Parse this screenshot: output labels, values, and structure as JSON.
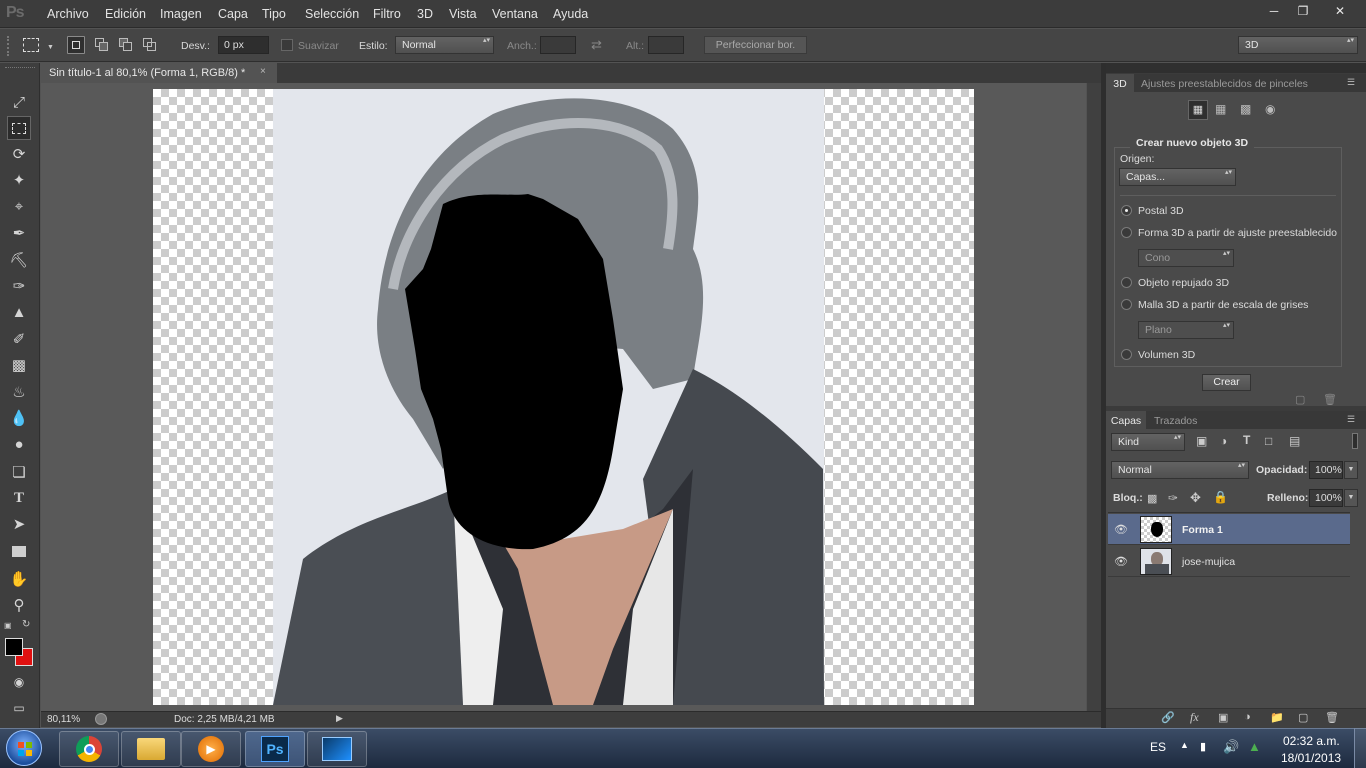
{
  "app": {
    "logo": "Ps"
  },
  "menu": [
    "Archivo",
    "Edición",
    "Imagen",
    "Capa",
    "Tipo",
    "Selección",
    "Filtro",
    "3D",
    "Vista",
    "Ventana",
    "Ayuda"
  ],
  "options": {
    "desv_label": "Desv.:",
    "desv_value": "0 px",
    "suavizar": "Suavizar",
    "estilo_label": "Estilo:",
    "estilo_value": "Normal",
    "anch_label": "Anch.:",
    "alt_label": "Alt.:",
    "refine_button": "Perfeccionar bor.",
    "workspace": "3D"
  },
  "document": {
    "tab_title": "Sin título-1 al 80,1% (Forma 1, RGB/8) *",
    "close": "×"
  },
  "status": {
    "zoom": "80,11%",
    "doc_info": "Doc: 2,25 MB/4,21 MB"
  },
  "panel3d": {
    "tabs": [
      "3D",
      "Ajustes preestablecidos de pinceles"
    ],
    "title": "Crear nuevo objeto 3D",
    "origen_label": "Origen:",
    "origen_value": "Capas...",
    "options": [
      {
        "label": "Postal 3D",
        "selected": true
      },
      {
        "label": "Forma 3D a partir de ajuste preestablecido",
        "selected": false
      },
      {
        "label": "Objeto repujado 3D",
        "selected": false
      },
      {
        "label": "Malla 3D a partir de escala de grises",
        "selected": false
      },
      {
        "label": "Volumen 3D",
        "selected": false
      }
    ],
    "shape_preset": "Cono",
    "mesh_preset": "Plano",
    "create_button": "Crear"
  },
  "layers": {
    "tabs": [
      "Capas",
      "Trazados"
    ],
    "kind_filter": "Kind",
    "blend_mode": "Normal",
    "opacity_label": "Opacidad:",
    "opacity_value": "100%",
    "lock_label": "Bloq.:",
    "fill_label": "Relleno:",
    "fill_value": "100%",
    "items": [
      {
        "name": "Forma 1",
        "visible": true,
        "selected": true
      },
      {
        "name": "jose-mujica",
        "visible": true,
        "selected": false
      }
    ]
  },
  "taskbar": {
    "language": "ES",
    "time": "02:32 a.m.",
    "date": "18/01/2013",
    "apps": [
      "start-orb-icon",
      "chrome-icon",
      "explorer-icon",
      "media-player-icon",
      "photoshop-icon",
      "monitor-app-icon"
    ]
  },
  "colors": {
    "foreground": "#000000",
    "background": "#e01010",
    "selected_layer": "#5a6a8c"
  }
}
